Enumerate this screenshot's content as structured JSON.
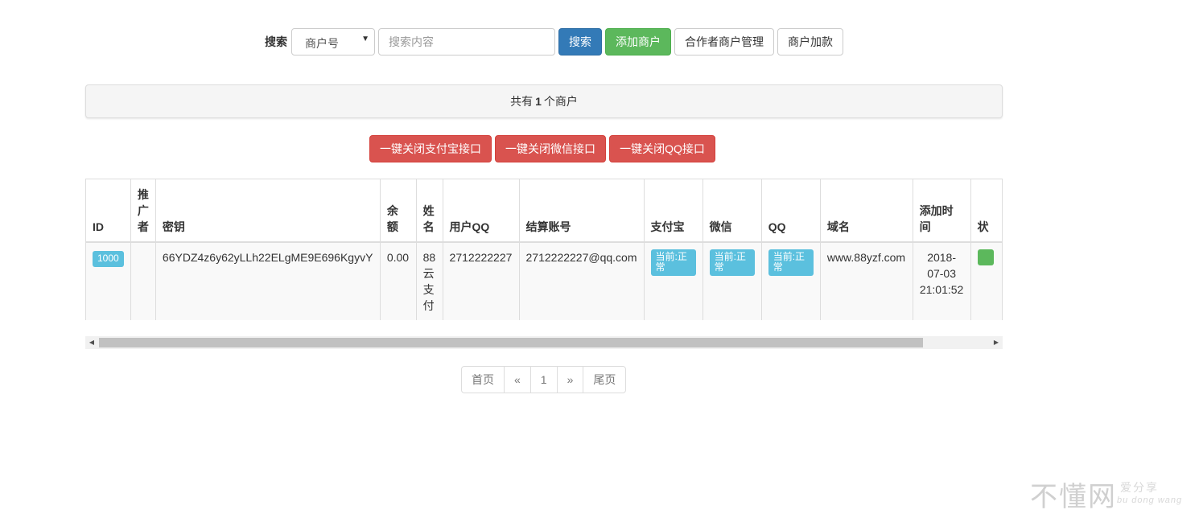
{
  "search": {
    "label": "搜索",
    "select_value": "商户号",
    "placeholder": "搜索内容",
    "search_button": "搜索",
    "add_button": "添加商户",
    "partner_button": "合作者商户管理",
    "recharge_button": "商户加款"
  },
  "summary": {
    "prefix": "共有",
    "count": "1",
    "suffix": "个商户"
  },
  "actions": {
    "close_alipay": "一键关闭支付宝接口",
    "close_wechat": "一键关闭微信接口",
    "close_qq": "一键关闭QQ接口"
  },
  "table": {
    "headers": [
      "ID",
      "推广者",
      "密钥",
      "余额",
      "姓名",
      "用户QQ",
      "结算账号",
      "支付宝",
      "微信",
      "QQ",
      "域名",
      "添加时间",
      "状"
    ],
    "row": {
      "id": "1000",
      "promoter": "",
      "key": "66YDZ4z6y62yLLh22ELgME9E696KgyvY",
      "balance": "0.00",
      "name": "88云支付",
      "user_qq": "2712222227",
      "account": "2712222227@qq.com",
      "alipay": "当前:正常",
      "wechat": "当前:正常",
      "qq": "当前:正常",
      "domain": "www.88yzf.com",
      "added_time": "2018-07-03 21:01:52"
    }
  },
  "pagination": {
    "first": "首页",
    "prev": "«",
    "page": "1",
    "next": "»",
    "last": "尾页"
  },
  "watermark": {
    "big": "不懂网",
    "small1": "爱分享",
    "small2": "bu dong wang"
  }
}
